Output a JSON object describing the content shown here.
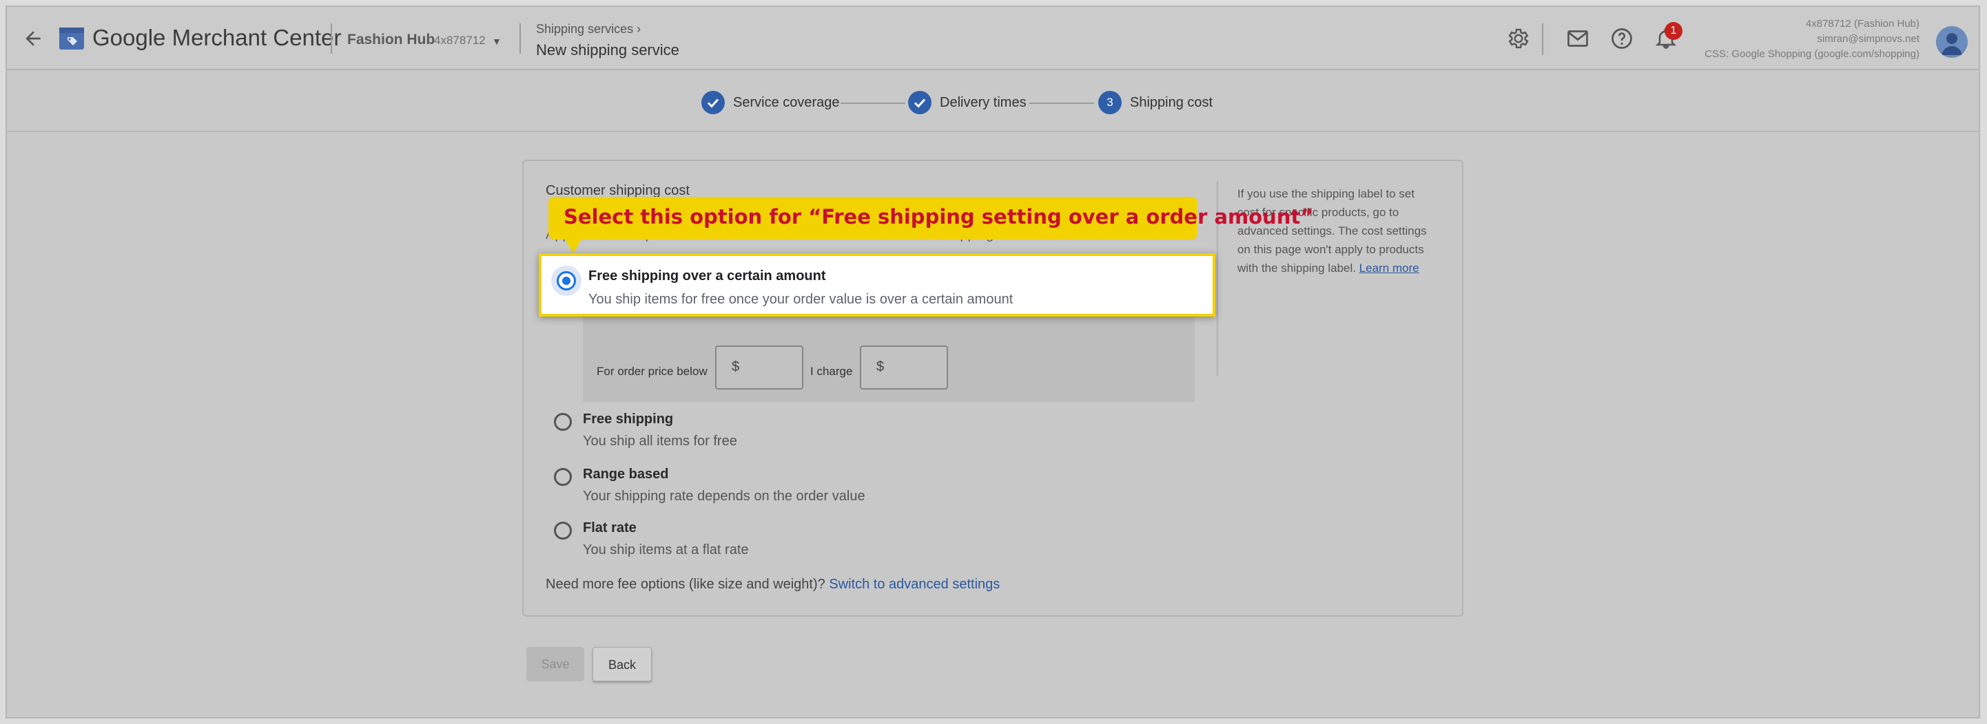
{
  "header": {
    "app_title": "Google Merchant Center",
    "account_name": "Fashion Hub",
    "account_id": "4x878712",
    "breadcrumb_parent": "Shipping services",
    "breadcrumb_current": "New shipping service",
    "notification_count": "1",
    "user_line1": "4x878712 (Fashion Hub)",
    "user_line2": "simran@simpnovs.net",
    "user_line3": "CSS: Google Shopping (google.com/shopping)"
  },
  "stepper": {
    "steps": [
      {
        "label": "Service coverage",
        "state": "done"
      },
      {
        "label": "Delivery times",
        "state": "done"
      },
      {
        "label": "Shipping cost",
        "number": "3",
        "state": "current"
      }
    ]
  },
  "card": {
    "heading": "Customer shipping cost",
    "subtext": "Applies to all ship from locations and carrier service levels in this shipping service.",
    "info_text": "If you use the shipping label to set cost for specific products, go to advanced settings. The cost settings on this page won't apply to products with the shipping label.",
    "info_link": "Learn more",
    "threshold": {
      "label_below": "For order price below",
      "currency1": "$",
      "label_charge": "I charge",
      "currency2": "$"
    },
    "options": [
      {
        "title": "Free shipping over a certain amount",
        "desc": "You ship items for free once your order value is over a certain amount",
        "selected": true
      },
      {
        "title": "Free shipping",
        "desc": "You ship all items for free"
      },
      {
        "title": "Range based",
        "desc": "Your shipping rate depends on the order value"
      },
      {
        "title": "Flat rate",
        "desc": "You ship items at a flat rate"
      }
    ],
    "footer_text": "Need more fee options (like size and weight)?",
    "footer_link": "Switch to advanced settings"
  },
  "buttons": {
    "save": "Save",
    "back": "Back"
  },
  "callout": {
    "text": "Select this option for “Free shipping setting over a order amount”"
  },
  "colors": {
    "accent": "#1a73e8",
    "callout_bg": "#f2d200",
    "callout_text": "#c8102e"
  }
}
